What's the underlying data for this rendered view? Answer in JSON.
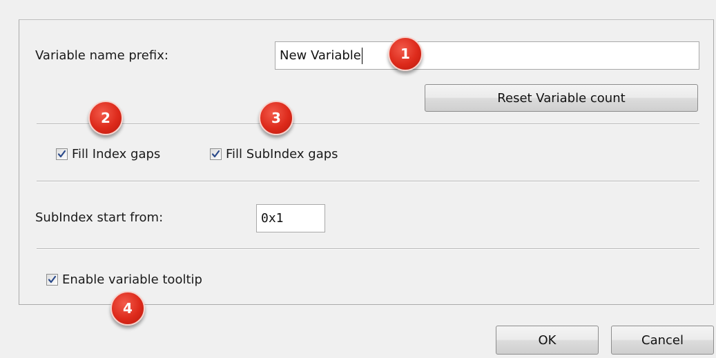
{
  "form": {
    "variable_prefix_label": "Variable name prefix:",
    "variable_prefix_value": "New Variable",
    "reset_button_label": "Reset Variable count",
    "fill_index_gaps_label": "Fill Index gaps",
    "fill_index_gaps_checked": true,
    "fill_subindex_gaps_label": "Fill SubIndex gaps",
    "fill_subindex_gaps_checked": true,
    "subindex_start_label": "SubIndex start from:",
    "subindex_start_value": "0x1",
    "enable_tooltip_label": "Enable variable tooltip",
    "enable_tooltip_checked": true
  },
  "footer": {
    "ok_label": "OK",
    "cancel_label": "Cancel"
  },
  "callouts": [
    "1",
    "2",
    "3",
    "4"
  ],
  "colors": {
    "callout_red": "#dd2a1b",
    "checkmark_blue": "#2b4a8a",
    "dialog_background": "#f0f0f0"
  }
}
